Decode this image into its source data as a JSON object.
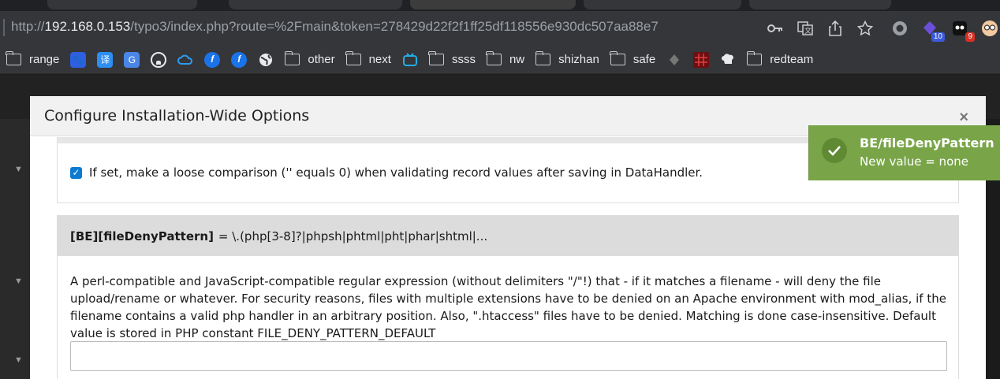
{
  "browser": {
    "url_prefix": "http://",
    "url_host": "192.168.0.153",
    "url_path": "/typo3/index.php?route=%2Fmain&token=278429d22f2f1ff25df118556e930dc507aa88e7",
    "extension_badges": [
      "10",
      "9"
    ]
  },
  "bookmarks": [
    {
      "label": "range",
      "icon": "folder-icon"
    },
    {
      "label": "",
      "icon": "baidu-icon"
    },
    {
      "label": "",
      "icon": "translate-icon"
    },
    {
      "label": "",
      "icon": "google-translate-icon"
    },
    {
      "label": "",
      "icon": "github-icon"
    },
    {
      "label": "",
      "icon": "cloud-icon"
    },
    {
      "label": "",
      "icon": "feather-icon"
    },
    {
      "label": "",
      "icon": "feather-icon"
    },
    {
      "label": "",
      "icon": "globe-icon"
    },
    {
      "label": "other",
      "icon": "folder-icon"
    },
    {
      "label": "next",
      "icon": "folder-icon"
    },
    {
      "label": "",
      "icon": "bilibili-icon"
    },
    {
      "label": "ssss",
      "icon": "folder-icon"
    },
    {
      "label": "nw",
      "icon": "folder-icon"
    },
    {
      "label": "shizhan",
      "icon": "folder-icon"
    },
    {
      "label": "safe",
      "icon": "folder-icon"
    },
    {
      "label": "redteam",
      "icon": "folder-icon"
    }
  ],
  "modal": {
    "title": "Configure Installation-Wide Options",
    "close_label": "×",
    "checkbox_label": "If set, make a loose comparison ('' equals 0) when validating record values after saving in DataHandler.",
    "setting_key": "[BE][fileDenyPattern]",
    "setting_value": "= \\.(php[3-8]?|phpsh|phtml|pht|phar|shtml|...",
    "setting_description": "A perl-compatible and JavaScript-compatible regular expression (without delimiters \"/\"!) that - if it matches a filename - will deny the file upload/rename or whatever. For security reasons, files with multiple extensions have to be denied on an Apache environment with mod_alias, if the filename contains a valid php handler in an arbitrary position. Also, \".htaccess\" files have to be denied. Matching is done case-insensitive. Default value is stored in PHP constant FILE_DENY_PATTERN_DEFAULT",
    "input_value": ""
  },
  "toast": {
    "title": "BE/fileDenyPattern",
    "message": "New value = none",
    "color": "#79a548"
  }
}
